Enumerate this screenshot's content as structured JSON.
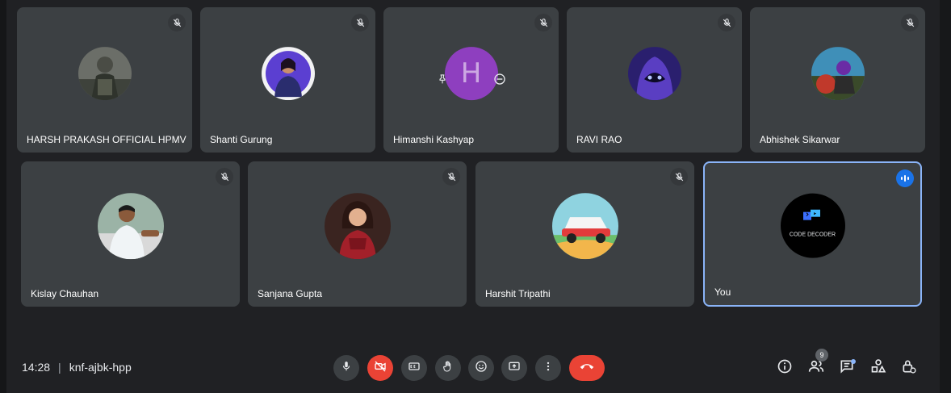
{
  "participants_row1": [
    {
      "name": "HARSH PRAKASH OFFICIAL HPMV",
      "muted": true
    },
    {
      "name": "Shanti Gurung",
      "muted": true
    },
    {
      "name": "Himanshi Kashyap",
      "muted": true
    },
    {
      "name": "RAVI RAO",
      "muted": true
    },
    {
      "name": "Abhishek Sikarwar",
      "muted": true
    }
  ],
  "participants_row2": [
    {
      "name": "Kislay Chauhan",
      "muted": true
    },
    {
      "name": "Sanjana Gupta",
      "muted": true
    },
    {
      "name": "Harshit Tripathi",
      "muted": true
    },
    {
      "name": "You",
      "muted": false,
      "speaking": true,
      "avatar_text": "CODE DECODER"
    }
  ],
  "meeting": {
    "time": "14:28",
    "code": "knf-ajbk-hpp"
  },
  "himanshi_avatar_letter": "H",
  "people_count": "9",
  "colors": {
    "accent": "#8ab4f8",
    "end_call": "#ea4335",
    "tile": "#3c4043",
    "background": "#202124"
  }
}
